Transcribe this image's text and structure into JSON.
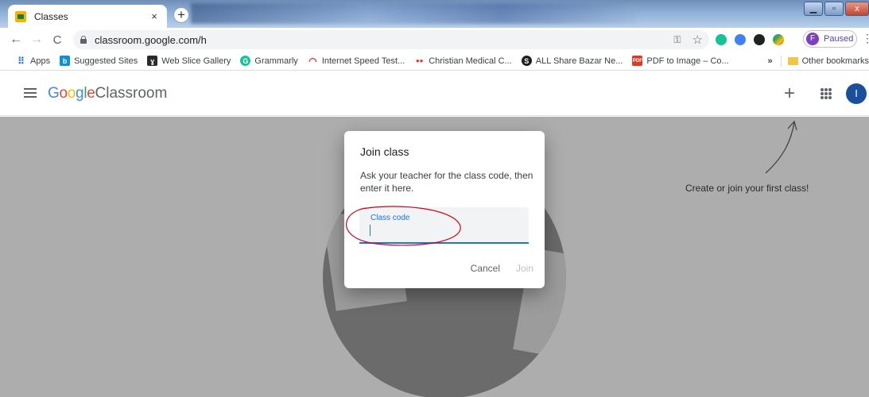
{
  "browser": {
    "tab_title": "Classes",
    "tab_close": "×",
    "new_tab": "+",
    "url": "classroom.google.com/h",
    "profile_initial": "F",
    "profile_label": "Paused",
    "window_close": "x"
  },
  "bookmarks": {
    "items": [
      {
        "label": "Apps",
        "icon": "apps-grid-icon"
      },
      {
        "label": "Suggested Sites",
        "icon": "bing-icon"
      },
      {
        "label": "Web Slice Gallery",
        "icon": "web-slice-icon"
      },
      {
        "label": "Grammarly",
        "icon": "grammarly-icon"
      },
      {
        "label": "Internet Speed Test...",
        "icon": "speedometer-icon"
      },
      {
        "label": "Christian Medical C...",
        "icon": "dots-icon"
      },
      {
        "label": "ALL Share Bazar Ne...",
        "icon": "share-icon"
      },
      {
        "label": "PDF to Image – Co...",
        "icon": "pdf-icon"
      }
    ],
    "overflow": "»",
    "other": "Other bookmarks"
  },
  "app": {
    "brand_google": "Google",
    "brand_product": "Classroom",
    "add_button": "+",
    "avatar_initial": "I",
    "empty_hint": "Create or join your first class!"
  },
  "dialog": {
    "title": "Join class",
    "description": "Ask your teacher for the class code, then enter it here.",
    "field_label": "Class code",
    "field_value": "",
    "cancel_label": "Cancel",
    "join_label": "Join"
  },
  "colors": {
    "accent": "#1a73e8",
    "annotation": "#d0021b"
  }
}
